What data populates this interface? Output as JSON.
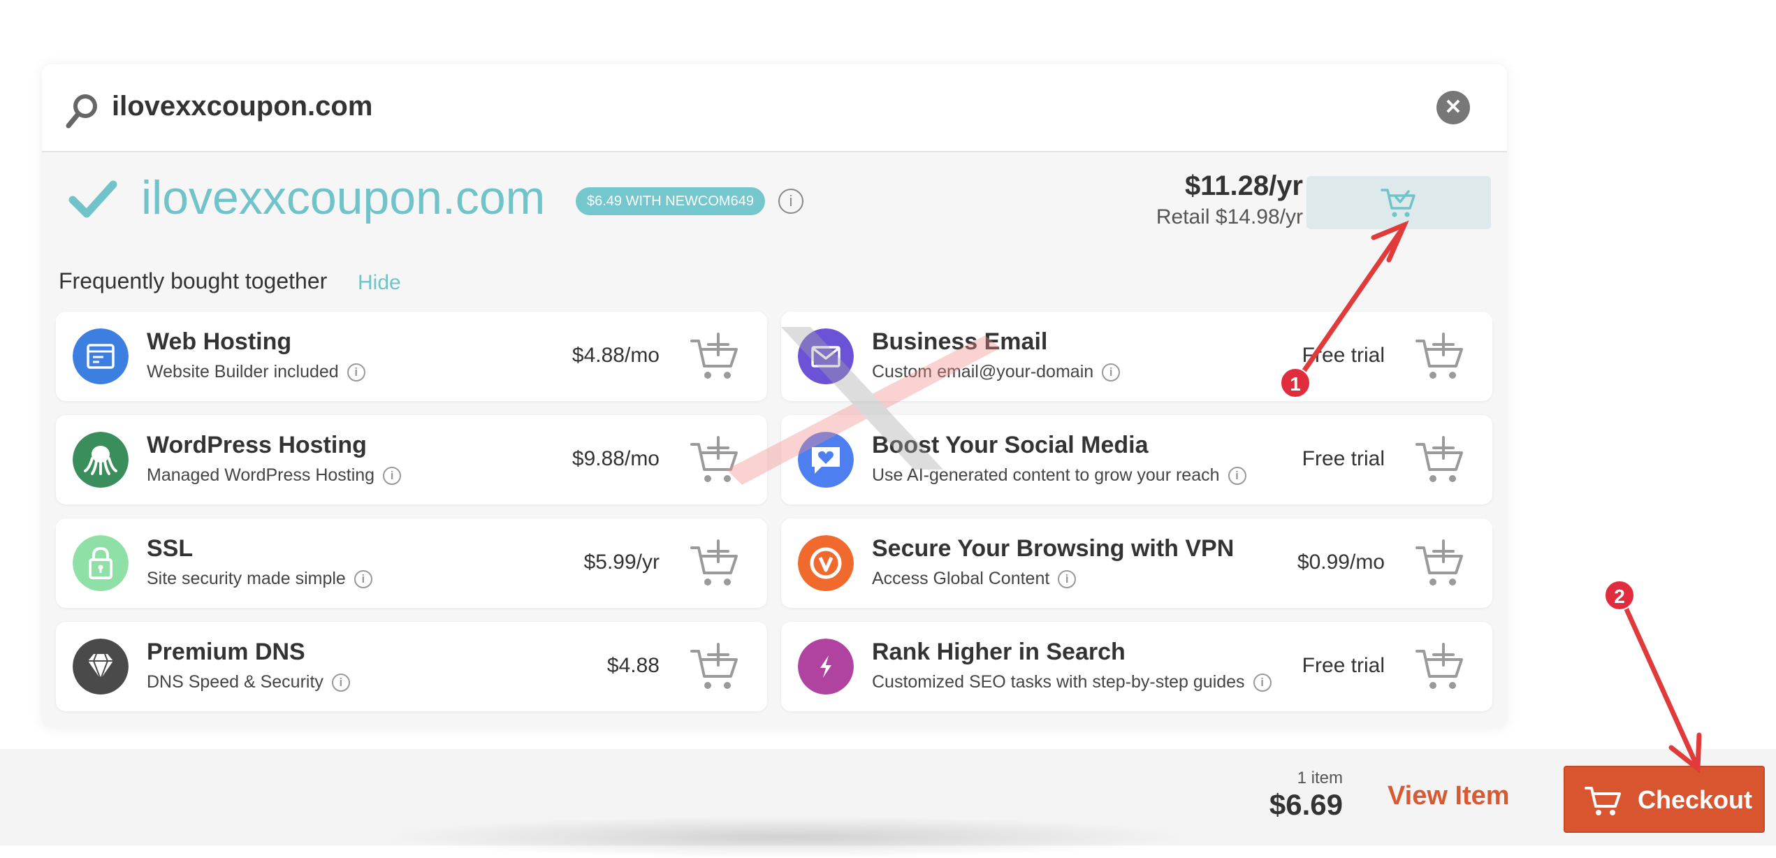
{
  "search": {
    "query": "ilovexxcoupon.com",
    "icons": {
      "search": "search-icon",
      "clear": "close-icon"
    },
    "clear_glyph": "✕"
  },
  "result": {
    "domain": "ilovexxcoupon.com",
    "promo_badge": "$6.49 WITH NEWCOM649",
    "price": "$11.28/yr",
    "retail": "Retail $14.98/yr",
    "info_glyph": "i",
    "icons": {
      "status": "checkmark-icon",
      "cart": "cart-added-icon"
    },
    "accent_color": "#6fc3c9"
  },
  "fbt": {
    "title": "Frequently bought together",
    "hide_label": "Hide",
    "items": [
      {
        "title": "Web Hosting",
        "subtitle": "Website Builder included",
        "price": "$4.88/mo",
        "icon": "web-hosting-icon",
        "color": "#3d7fe0"
      },
      {
        "title": "Business Email",
        "subtitle": "Custom email@your-domain",
        "price": "Free trial",
        "icon": "email-icon",
        "color": "#6b52d6"
      },
      {
        "title": "WordPress Hosting",
        "subtitle": "Managed WordPress Hosting",
        "price": "$9.88/mo",
        "icon": "octopus-icon",
        "color": "#3a8e5c"
      },
      {
        "title": "Boost Your Social Media",
        "subtitle": "Use AI-generated content to grow your reach",
        "price": "Free trial",
        "icon": "heart-chat-icon",
        "color": "#4d7ff0"
      },
      {
        "title": "SSL",
        "subtitle": "Site security made simple",
        "price": "$5.99/yr",
        "icon": "lock-icon",
        "color": "#8ee0a6"
      },
      {
        "title": "Secure Your Browsing with VPN",
        "subtitle": "Access Global Content",
        "price": "$0.99/mo",
        "icon": "vpn-icon",
        "color": "#ef6a2c"
      },
      {
        "title": "Premium DNS",
        "subtitle": "DNS Speed & Security",
        "price": "$4.88",
        "icon": "diamond-icon",
        "color": "#4a4a4a"
      },
      {
        "title": "Rank Higher in Search",
        "subtitle": "Customized SEO tasks with step-by-step guides",
        "price": "Free trial",
        "icon": "lightning-icon",
        "color": "#b0439f"
      }
    ]
  },
  "footer": {
    "item_count": "1 item",
    "total": "$6.69",
    "view_label": "View Item",
    "checkout_label": "Checkout",
    "checkout_color": "#d8552f"
  },
  "annotations": {
    "marker_1": "1",
    "marker_2": "2",
    "color": "#e02c3c"
  }
}
